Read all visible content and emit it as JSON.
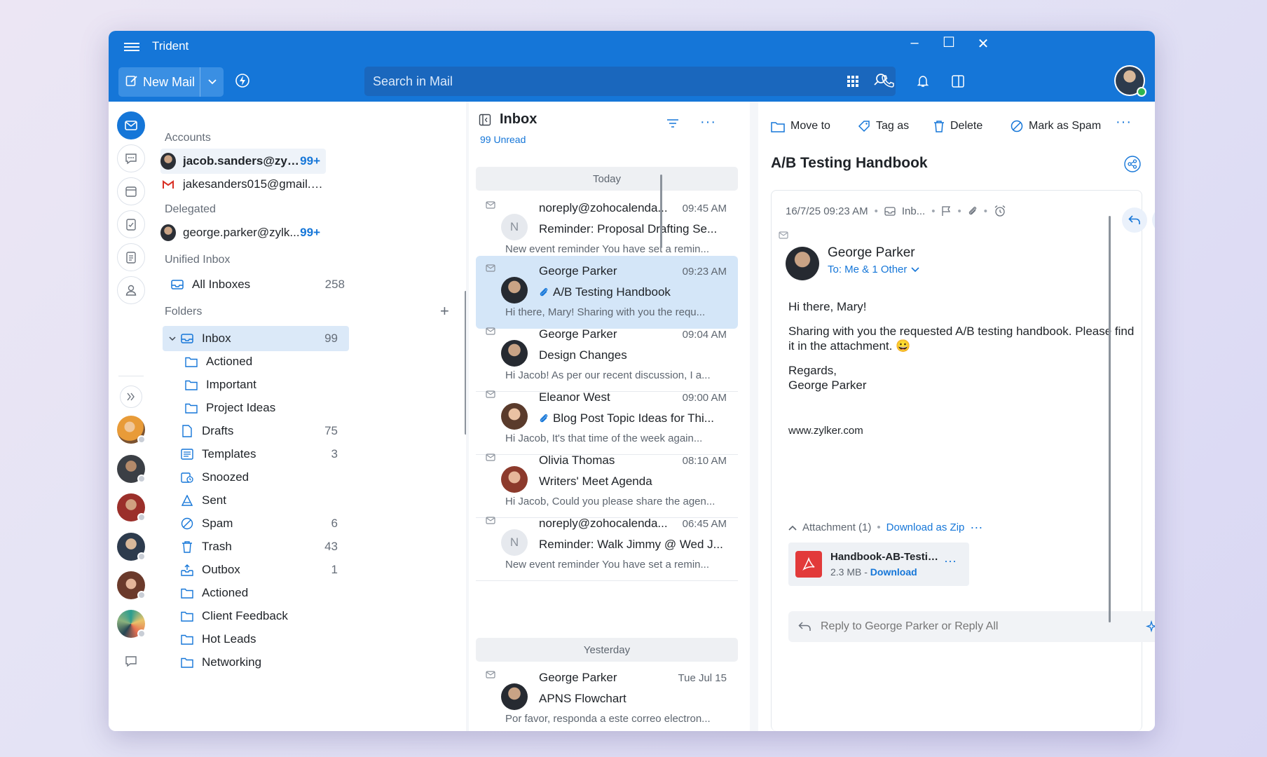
{
  "app": {
    "title": "Trident"
  },
  "header": {
    "new_mail_label": "New Mail",
    "search_placeholder": "Search in Mail"
  },
  "accounts": {
    "heading": "Accounts",
    "items": [
      {
        "label": "jacob.sanders@zylk...",
        "count": "99+"
      },
      {
        "label": "jakesanders015@gmail.c..."
      }
    ],
    "delegated_heading": "Delegated",
    "delegated": [
      {
        "label": "george.parker@zylk...",
        "count": "99+"
      }
    ],
    "unified_heading": "Unified Inbox",
    "unified": [
      {
        "label": "All Inboxes",
        "count": "258"
      }
    ],
    "folders_heading": "Folders"
  },
  "folders": [
    {
      "label": "Inbox",
      "count": "99",
      "icon": "inbox-icon"
    },
    {
      "label": "Actioned",
      "icon": "folder-icon"
    },
    {
      "label": "Important",
      "icon": "folder-icon"
    },
    {
      "label": "Project Ideas",
      "icon": "folder-icon"
    },
    {
      "label": "Drafts",
      "count": "75",
      "icon": "draft-icon"
    },
    {
      "label": "Templates",
      "count": "3",
      "icon": "template-icon"
    },
    {
      "label": "Snoozed",
      "icon": "snooze-icon"
    },
    {
      "label": "Sent",
      "icon": "sent-icon"
    },
    {
      "label": "Spam",
      "count": "6",
      "icon": "spam-icon"
    },
    {
      "label": "Trash",
      "count": "43",
      "icon": "trash-icon"
    },
    {
      "label": "Outbox",
      "count": "1",
      "icon": "outbox-icon"
    },
    {
      "label": "Actioned",
      "icon": "folder-icon"
    },
    {
      "label": "Client Feedback",
      "icon": "folder-icon"
    },
    {
      "label": "Hot Leads",
      "icon": "folder-icon"
    },
    {
      "label": "Networking",
      "icon": "folder-icon"
    }
  ],
  "mail_list": {
    "title": "Inbox",
    "unread": "99 Unread",
    "today_label": "Today",
    "yesterday_label": "Yesterday",
    "mails": [
      {
        "from": "noreply@zohocalenda...",
        "time": "09:45 AM",
        "subject": "Reminder: Proposal Drafting Se...",
        "preview": "New event reminder You have set a remin...",
        "initial": "N"
      },
      {
        "from": "George Parker",
        "time": "09:23 AM",
        "subject": "A/B Testing Handbook",
        "preview": "Hi there, Mary! Sharing with you the requ..."
      },
      {
        "from": "George Parker",
        "time": "09:04 AM",
        "subject": "Design Changes",
        "preview": "Hi Jacob! As per our recent discussion, I a..."
      },
      {
        "from": "Eleanor West",
        "time": "09:00 AM",
        "subject": "Blog Post Topic Ideas for Thi...",
        "preview": "Hi Jacob, It's that time of the week again..."
      },
      {
        "from": "Olivia Thomas",
        "time": "08:10 AM",
        "subject": "Writers' Meet Agenda",
        "preview": "Hi Jacob, Could you please share the agen..."
      },
      {
        "from": "noreply@zohocalenda...",
        "time": "06:45 AM",
        "subject": "Reminder: Walk Jimmy @ Wed J...",
        "preview": "New event reminder You have set a remin...",
        "initial": "N"
      },
      {
        "from": "George Parker",
        "time": "Tue Jul 15",
        "subject": "APNS Flowchart",
        "preview": "Por favor, responda a este correo electron..."
      }
    ]
  },
  "reader": {
    "toolbar": {
      "move": "Move to",
      "tag": "Tag as",
      "delete": "Delete",
      "spam": "Mark as Spam"
    },
    "subject": "A/B Testing Handbook",
    "date": "16/7/25 09:23 AM",
    "folder": "Inb...",
    "sender": "George Parker",
    "to": "To: Me & 1 Other",
    "body": {
      "greeting": "Hi there, Mary!",
      "line1": "Sharing with you the requested A/B testing handbook. Please find it in the attachment. 😀",
      "regards": "Regards,",
      "signature": "George Parker",
      "website": "www.zylker.com"
    },
    "attachment_header": "Attachment (1)",
    "download_zip": "Download as Zip",
    "attachment": {
      "name": "Handbook-AB-Testing...",
      "size": "2.3 MB - ",
      "download": "Download"
    },
    "reply_placeholder": "Reply to George Parker or Reply All"
  },
  "colors": {
    "accent": "#1576d8",
    "selected": "#d4e6f8",
    "pdf": "#e23a3a"
  }
}
